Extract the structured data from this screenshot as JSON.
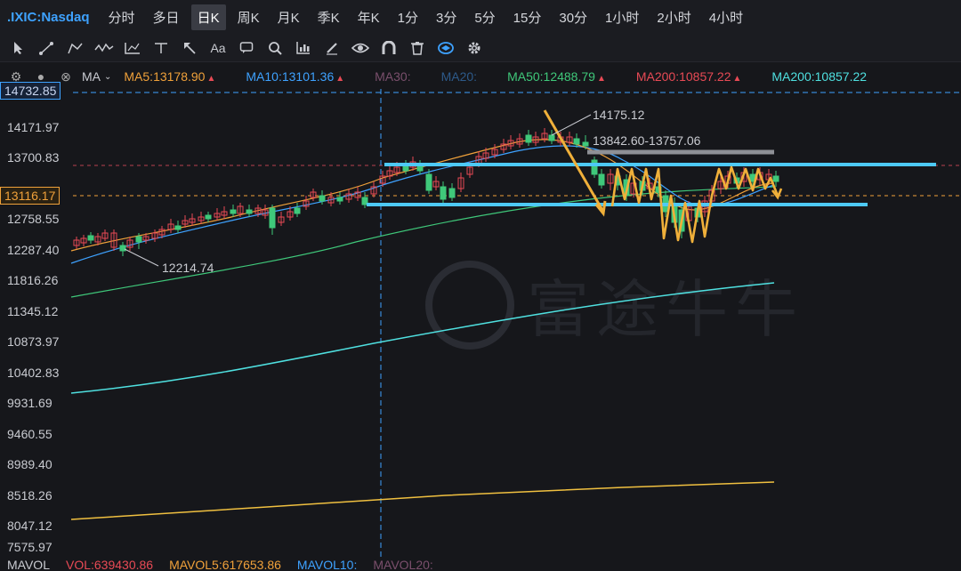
{
  "header": {
    "symbol": ".IXIC:Nasdaq",
    "timeframes": [
      "分时",
      "多日",
      "日K",
      "周K",
      "月K",
      "季K",
      "年K",
      "1分",
      "3分",
      "5分",
      "15分",
      "30分",
      "1小时",
      "2小时",
      "4小时"
    ],
    "active_timeframe": "日K"
  },
  "toolbar": {
    "tools": [
      "pointer-icon",
      "line-tool-icon",
      "path-tool-icon",
      "wave-tool-icon",
      "fibonacci-tool-icon",
      "horizontal-line-icon",
      "arrow-tool-icon",
      "text-tool-icon",
      "comment-icon",
      "search-icon",
      "chart-settings-icon",
      "brush-icon",
      "visibility-icon",
      "magnet-icon",
      "trash-icon",
      "sync-icon",
      "gear-icon"
    ],
    "text_tool_label": "Aa"
  },
  "ma_legend": {
    "label": "MA",
    "items": [
      {
        "text": "MA5:13178.90",
        "color": "#f0a13a",
        "up": true
      },
      {
        "text": "MA10:13101.36",
        "color": "#3ea2ff",
        "up": true
      },
      {
        "text": "MA30:",
        "color": "#7a4f6c",
        "up": false
      },
      {
        "text": "MA20:",
        "color": "#2d5a8a",
        "up": false
      },
      {
        "text": "MA50:12488.79",
        "color": "#3fc87a",
        "up": true
      },
      {
        "text": "MA200:10857.22",
        "color": "#e84a55",
        "up": true
      },
      {
        "text": "MA200:10857.22",
        "color": "#4fe0e0",
        "up": false
      }
    ]
  },
  "price_axis": {
    "labels": [
      "14171.97",
      "13700.83",
      "12758.55",
      "12287.40",
      "11816.26",
      "11345.12",
      "10873.97",
      "10402.83",
      "9931.69",
      "9460.55",
      "8989.40",
      "8518.26",
      "8047.12",
      "7575.97"
    ],
    "crosshair_label": "14732.85",
    "current_label": "13116.17"
  },
  "annotations": {
    "high": "14175.12",
    "low": "12214.74",
    "range": "13842.60-13757.06"
  },
  "watermark": "富途牛牛",
  "colors": {
    "up": "#e84a55",
    "down": "#3fc87a",
    "accent": "#3ea2ff",
    "ma5": "#f0a13a",
    "ma10": "#3ea2ff",
    "ma50": "#3fc87a",
    "ma200": "#4fe0e0",
    "ma_long": "#f0c040",
    "support": "#4dc9f6",
    "arrow": "#f0b03a"
  },
  "volume_bar": {
    "items": [
      {
        "text": "MAVOL",
        "color": "#c9cbd1"
      },
      {
        "text": "VOL:639430.86",
        "color": "#e84a55"
      },
      {
        "text": "MAVOL5:617653.86",
        "color": "#f0a13a"
      },
      {
        "text": "MAVOL10:",
        "color": "#3ea2ff"
      },
      {
        "text": "MAVOL20:",
        "color": "#7a4f6c"
      }
    ]
  }
}
